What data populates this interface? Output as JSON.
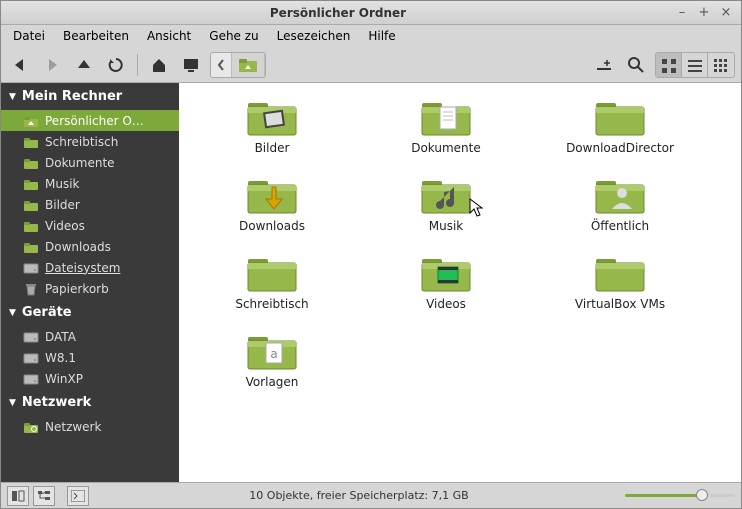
{
  "window": {
    "title": "Persönlicher Ordner"
  },
  "menu": {
    "file": "Datei",
    "edit": "Bearbeiten",
    "view": "Ansicht",
    "go": "Gehe zu",
    "bookmarks": "Lesezeichen",
    "help": "Hilfe"
  },
  "sidebar": {
    "sections": {
      "computer": {
        "label": "Mein Rechner",
        "items": [
          {
            "key": "home",
            "label": "Persönlicher O…",
            "selected": true,
            "icon": "home"
          },
          {
            "key": "desktop",
            "label": "Schreibtisch",
            "icon": "folder"
          },
          {
            "key": "documents",
            "label": "Dokumente",
            "icon": "folder"
          },
          {
            "key": "music",
            "label": "Musik",
            "icon": "folder"
          },
          {
            "key": "pictures",
            "label": "Bilder",
            "icon": "folder"
          },
          {
            "key": "videos",
            "label": "Videos",
            "icon": "folder"
          },
          {
            "key": "downloads",
            "label": "Downloads",
            "icon": "folder"
          },
          {
            "key": "filesystem",
            "label": "Dateisystem",
            "icon": "drive",
            "underline": true
          },
          {
            "key": "trash",
            "label": "Papierkorb",
            "icon": "trash"
          }
        ]
      },
      "devices": {
        "label": "Geräte",
        "items": [
          {
            "key": "data",
            "label": "DATA",
            "icon": "drive"
          },
          {
            "key": "w81",
            "label": "W8.1",
            "icon": "drive"
          },
          {
            "key": "winxp",
            "label": "WinXP",
            "icon": "drive"
          }
        ]
      },
      "network": {
        "label": "Netzwerk",
        "items": [
          {
            "key": "network",
            "label": "Netzwerk",
            "icon": "network"
          }
        ]
      }
    }
  },
  "folders": [
    {
      "key": "bilder",
      "label": "Bilder",
      "icon": "pictures"
    },
    {
      "key": "dokumente",
      "label": "Dokumente",
      "icon": "documents"
    },
    {
      "key": "downloaddirector",
      "label": "DownloadDirector",
      "icon": "plain"
    },
    {
      "key": "downloads",
      "label": "Downloads",
      "icon": "downloads"
    },
    {
      "key": "musik",
      "label": "Musik",
      "icon": "music"
    },
    {
      "key": "oeffentlich",
      "label": "Öffentlich",
      "icon": "public"
    },
    {
      "key": "schreibtisch",
      "label": "Schreibtisch",
      "icon": "plain"
    },
    {
      "key": "videos",
      "label": "Videos",
      "icon": "videos"
    },
    {
      "key": "virtualbox",
      "label": "VirtualBox VMs",
      "icon": "plain"
    },
    {
      "key": "vorlagen",
      "label": "Vorlagen",
      "icon": "templates"
    }
  ],
  "status": {
    "text": "10 Objekte, freier Speicherplatz: 7,1 GB"
  }
}
